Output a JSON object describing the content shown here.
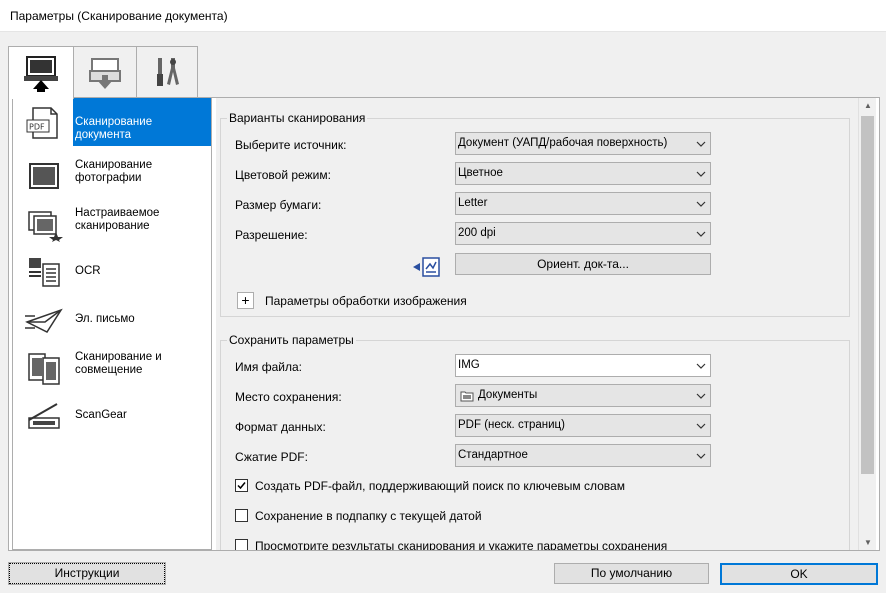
{
  "window": {
    "title": "Параметры (Сканирование документа)"
  },
  "tabs": [
    {
      "name": "tab-scan-from-computer",
      "icon": "computer-icon",
      "selected": true
    },
    {
      "name": "tab-scan-from-panel",
      "icon": "tray-download-icon",
      "selected": false
    },
    {
      "name": "tab-general-settings",
      "icon": "tools-icon",
      "selected": false
    }
  ],
  "nav": {
    "items": [
      {
        "label": "Сканирование документа",
        "icon": "pdf-document-icon",
        "selected": true
      },
      {
        "label": "Сканирование фотографии",
        "icon": "photo-icon",
        "selected": false
      },
      {
        "label": "Настраиваемое сканирование",
        "icon": "custom-scan-icon",
        "selected": false
      },
      {
        "label": "OCR",
        "icon": "ocr-icon",
        "selected": false
      },
      {
        "label": "Эл. письмо",
        "icon": "email-icon",
        "selected": false
      },
      {
        "label": "Сканирование и совмещение",
        "icon": "stitch-icon",
        "selected": false
      },
      {
        "label": "ScanGear",
        "icon": "scangear-icon",
        "selected": false
      }
    ]
  },
  "scan_options": {
    "group_title": "Варианты сканирования",
    "source_label": "Выберите источник:",
    "source_value": "Документ (УАПД/рабочая поверхность)",
    "color_label": "Цветовой режим:",
    "color_value": "Цветное",
    "paper_label": "Размер бумаги:",
    "paper_value": "Letter",
    "resolution_label": "Разрешение:",
    "resolution_value": "200 dpi",
    "orient_button": "Ориент. док-та...",
    "expander_symbol": "+",
    "image_processing_label": "Параметры обработки изображения"
  },
  "save_options": {
    "group_title": "Сохранить параметры",
    "filename_label": "Имя файла:",
    "filename_value": "IMG",
    "location_label": "Место сохранения:",
    "location_value": "Документы",
    "format_label": "Формат данных:",
    "format_value": "PDF (неск. страниц)",
    "compression_label": "Сжатие PDF:",
    "compression_value": "Стандартное",
    "searchable_pdf_label": "Создать PDF-файл, поддерживающий поиск по ключевым словам",
    "searchable_pdf_checked": true,
    "date_subfolder_label": "Сохранение в подпапку с текущей датой",
    "date_subfolder_checked": false,
    "review_label": "Просмотрите результаты сканирования и укажите параметры сохранения",
    "review_checked": false
  },
  "buttons": {
    "instructions": "Инструкции",
    "defaults": "По умолчанию",
    "ok": "OK"
  },
  "colors": {
    "accent": "#0078d7",
    "window_bg": "#f0f0f0",
    "panel_bg": "#ffffff",
    "border": "#adadad"
  }
}
